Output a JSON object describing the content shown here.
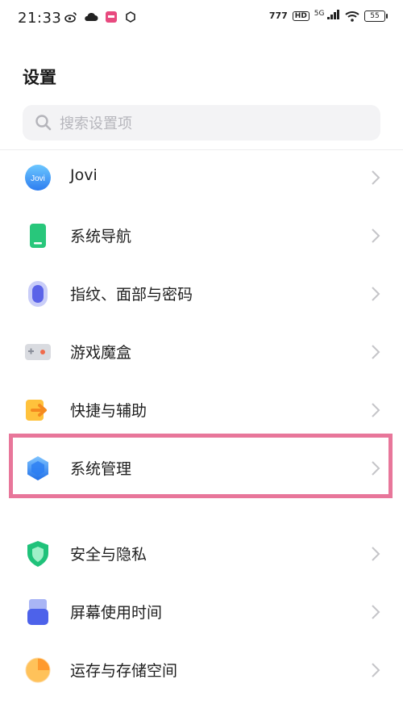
{
  "status_bar": {
    "time": "21:33",
    "network_label": "5G",
    "hd_label": "HD",
    "carrier_glyph": "777",
    "battery": "55",
    "left_icons": [
      "weibo-icon",
      "cloud-icon",
      "app-badge-icon",
      "sync-icon"
    ]
  },
  "page": {
    "title": "设置"
  },
  "search": {
    "placeholder": "搜索设置项"
  },
  "items": [
    {
      "label": "Jovi",
      "icon": "jovi-icon"
    },
    {
      "label": "系统导航",
      "icon": "navigation-icon"
    },
    {
      "label": "指纹、面部与密码",
      "icon": "fingerprint-icon"
    },
    {
      "label": "游戏魔盒",
      "icon": "game-box-icon"
    },
    {
      "label": "快捷与辅助",
      "icon": "shortcut-icon"
    },
    {
      "label": "系统管理",
      "icon": "system-manage-icon",
      "highlighted": true
    },
    {
      "label": "安全与隐私",
      "icon": "shield-icon"
    },
    {
      "label": "屏幕使用时间",
      "icon": "screen-time-icon"
    },
    {
      "label": "运存与存储空间",
      "icon": "storage-icon"
    }
  ],
  "colors": {
    "highlight": "#e8769a",
    "search_bg": "#f3f3f5"
  }
}
